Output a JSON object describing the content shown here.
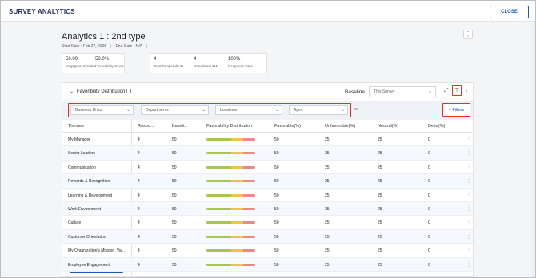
{
  "header": {
    "title": "SURVEY ANALYTICS",
    "close_label": "CLOSE"
  },
  "page": {
    "title": "Analytics 1 : 2nd type",
    "start_date": "Start Date : Feb 27, 2025",
    "end_date": "End Date : N/A",
    "menu_icon": "kebab-icon"
  },
  "stats": [
    {
      "value": "50.00",
      "label": "Engagement Index"
    },
    {
      "value": "50.0%",
      "label": "Favorability Score"
    },
    {
      "value": "4",
      "label": "Total Respondents"
    },
    {
      "value": "4",
      "label": "Completed 111"
    },
    {
      "value": "100%",
      "label": "Response Rate"
    }
  ],
  "panel": {
    "title": "Favoribility Distribution",
    "baseline_label": "Baseline",
    "baseline_value": "This Survey",
    "filters": [
      "Business Units",
      "Departments",
      "Locations",
      "Ages"
    ],
    "add_filters_label": "+ Filters"
  },
  "table": {
    "columns": [
      "Themes",
      "Respo...",
      "Baseli...",
      "Favorability Distribution",
      "Favorable(%)",
      "Unfavorable(%)",
      "Neutral(%)",
      "Delta(%)"
    ],
    "rows": [
      {
        "theme": "My Manager",
        "respondents": "4",
        "baseline": "50",
        "favorable": "50",
        "unfavorable": "25",
        "neutral": "25",
        "delta": "0"
      },
      {
        "theme": "Senior Leaders",
        "respondents": "4",
        "baseline": "50",
        "favorable": "50",
        "unfavorable": "25",
        "neutral": "25",
        "delta": "0"
      },
      {
        "theme": "Communication",
        "respondents": "4",
        "baseline": "50",
        "favorable": "50",
        "unfavorable": "25",
        "neutral": "25",
        "delta": "0"
      },
      {
        "theme": "Rewards & Recognition",
        "respondents": "4",
        "baseline": "50",
        "favorable": "50",
        "unfavorable": "25",
        "neutral": "25",
        "delta": "0"
      },
      {
        "theme": "Learning & Development",
        "respondents": "4",
        "baseline": "50",
        "favorable": "50",
        "unfavorable": "25",
        "neutral": "25",
        "delta": "0"
      },
      {
        "theme": "Work Environment",
        "respondents": "4",
        "baseline": "50",
        "favorable": "50",
        "unfavorable": "25",
        "neutral": "25",
        "delta": "0"
      },
      {
        "theme": "Culture",
        "respondents": "4",
        "baseline": "50",
        "favorable": "50",
        "unfavorable": "25",
        "neutral": "25",
        "delta": "0"
      },
      {
        "theme": "Customer Orientation",
        "respondents": "4",
        "baseline": "50",
        "favorable": "50",
        "unfavorable": "25",
        "neutral": "25",
        "delta": "0"
      },
      {
        "theme": "My Organization's Mission, Va...",
        "respondents": "4",
        "baseline": "50",
        "favorable": "50",
        "unfavorable": "25",
        "neutral": "25",
        "delta": "0"
      },
      {
        "theme": "Employee Engagement",
        "respondents": "4",
        "baseline": "50",
        "favorable": "50",
        "unfavorable": "25",
        "neutral": "25",
        "delta": "0"
      }
    ]
  },
  "colors": {
    "favorable": "#a8c35a",
    "neutral": "#f0c24a",
    "unfavorable": "#e88a8a",
    "accent": "#1d58b9",
    "highlight": "#e0301e"
  }
}
